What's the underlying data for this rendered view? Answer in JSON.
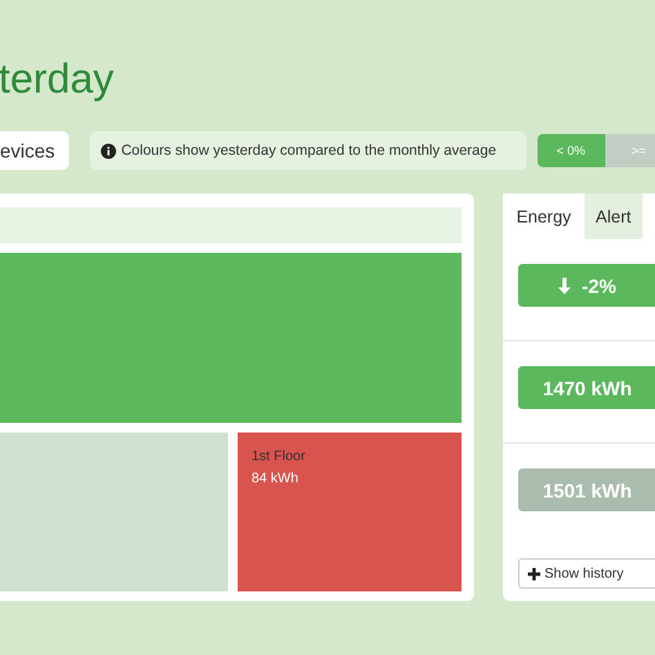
{
  "title": "terday",
  "view_tab": {
    "label": "evices"
  },
  "info": {
    "text": "Colours show yesterday compared to the monthly average"
  },
  "legend": [
    {
      "label": "< 0%",
      "color": "#5cb85c"
    },
    {
      "label": ">=",
      "color": "#c2cdc4"
    }
  ],
  "treemap": {
    "tiles": [
      {
        "kind": "strip",
        "color": "#e8f3e4"
      },
      {
        "kind": "tile",
        "color": "#5cb85c"
      },
      {
        "kind": "tile",
        "color": "#d0e0d3"
      },
      {
        "kind": "tile",
        "color": "#d9534f",
        "name": "1st Floor",
        "value": "84 kWh"
      }
    ]
  },
  "side_tabs": [
    {
      "label": "Energy",
      "selected": true
    },
    {
      "label": "Alert",
      "selected": false
    }
  ],
  "metrics": [
    {
      "kind": "arrow-down",
      "value": "-2%",
      "color": "#5cb85c"
    },
    {
      "kind": "plain",
      "value": "1470 kWh",
      "color": "#5cb85c"
    },
    {
      "kind": "plain",
      "value": "1501 kWh",
      "color": "#a9bcae"
    }
  ],
  "history_button": {
    "label": "Show history"
  }
}
